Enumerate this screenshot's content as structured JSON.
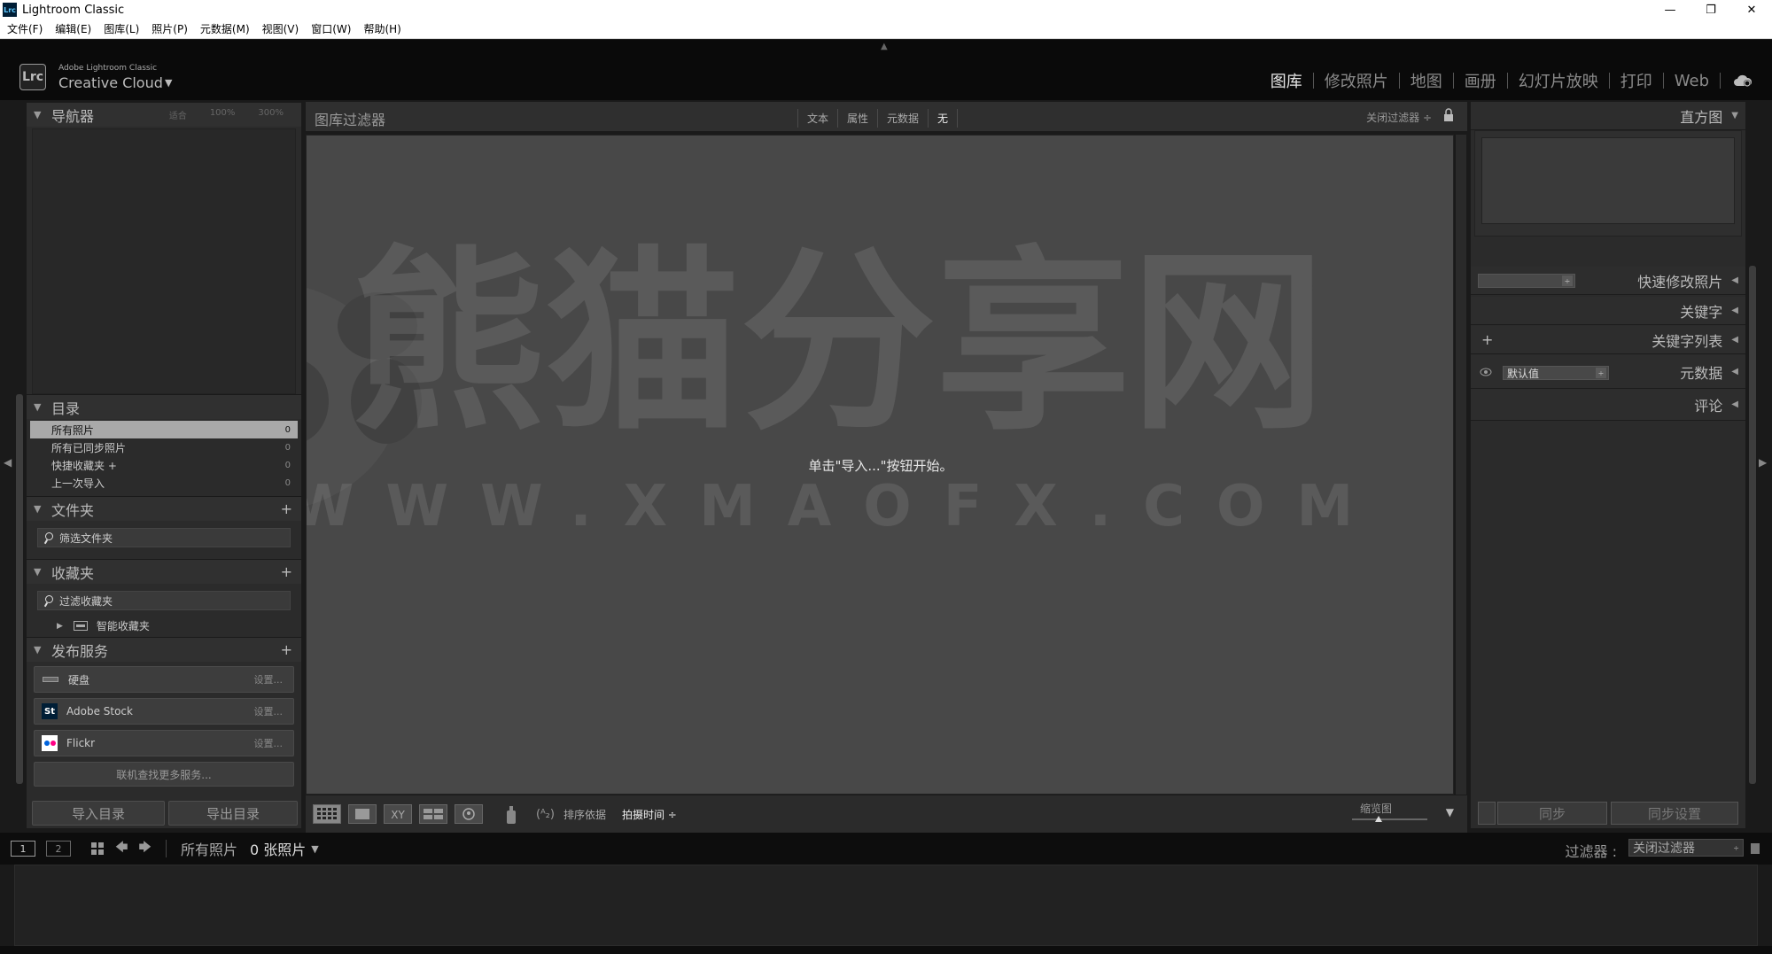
{
  "window": {
    "app_title": "Lightroom Classic",
    "app_icon_text": "Lrc",
    "min": "—",
    "max": "❐",
    "close": "✕"
  },
  "menu": [
    "文件(F)",
    "编辑(E)",
    "图库(L)",
    "照片(P)",
    "元数据(M)",
    "视图(V)",
    "窗口(W)",
    "帮助(H)"
  ],
  "identity": {
    "logo": "Lrc",
    "small": "Adobe Lightroom Classic",
    "big": "Creative Cloud",
    "caret": "▼"
  },
  "modules": [
    {
      "label": "图库",
      "active": true
    },
    {
      "label": "修改照片"
    },
    {
      "label": "地图"
    },
    {
      "label": "画册"
    },
    {
      "label": "幻灯片放映"
    },
    {
      "label": "打印"
    },
    {
      "label": "Web"
    }
  ],
  "left": {
    "navigator": {
      "title": "导航器",
      "opts": [
        "适合",
        "100%",
        "300%"
      ]
    },
    "catalog": {
      "title": "目录",
      "items": [
        {
          "label": "所有照片",
          "count": "0"
        },
        {
          "label": "所有已同步照片",
          "count": "0"
        },
        {
          "label": "快捷收藏夹 +",
          "count": "0"
        },
        {
          "label": "上一次导入",
          "count": "0"
        }
      ]
    },
    "folders": {
      "title": "文件夹",
      "plus": "+",
      "search": "筛选文件夹"
    },
    "collections": {
      "title": "收藏夹",
      "plus": "+",
      "search": "过滤收藏夹",
      "smart": "智能收藏夹"
    },
    "publish": {
      "title": "发布服务",
      "plus": "+",
      "services": [
        {
          "name": "硬盘",
          "setup": "设置..."
        },
        {
          "name": "Adobe Stock",
          "icon": "St",
          "setup": "设置..."
        },
        {
          "name": "Flickr",
          "setup": "设置..."
        }
      ],
      "find_more": "联机查找更多服务..."
    },
    "import_btn": "导入目录",
    "export_btn": "导出目录"
  },
  "center": {
    "filter_title": "图库过滤器",
    "filter_tabs": [
      {
        "label": "文本"
      },
      {
        "label": "属性"
      },
      {
        "label": "元数据"
      },
      {
        "label": "无",
        "active": true
      }
    ],
    "filter_close": "关闭过滤器 ÷",
    "empty_msg": "单击\"导入...\"按钮开始。",
    "sort_label": "排序依据",
    "sort_value": "拍摄时间 ÷",
    "thumb_label": "缩览图",
    "thumb_level": 0.35
  },
  "right": {
    "histogram": "直方图",
    "quick_develop": "快速修改照片",
    "keywording": "关键字",
    "keyword_list": "关键字列表",
    "keyword_plus": "+",
    "metadata": "元数据",
    "metadata_preset": "默认值",
    "comments": "评论",
    "sync": "同步",
    "sync_settings": "同步设置"
  },
  "filmstrip": {
    "view1": "1",
    "view2": "2",
    "source": "所有照片",
    "count": "0 张照片",
    "filter_label": "过滤器 :",
    "filter_value": "关闭过滤器"
  },
  "watermark": {
    "cn": "熊猫分享网",
    "en": "WWW.XMAOFX.COM"
  }
}
